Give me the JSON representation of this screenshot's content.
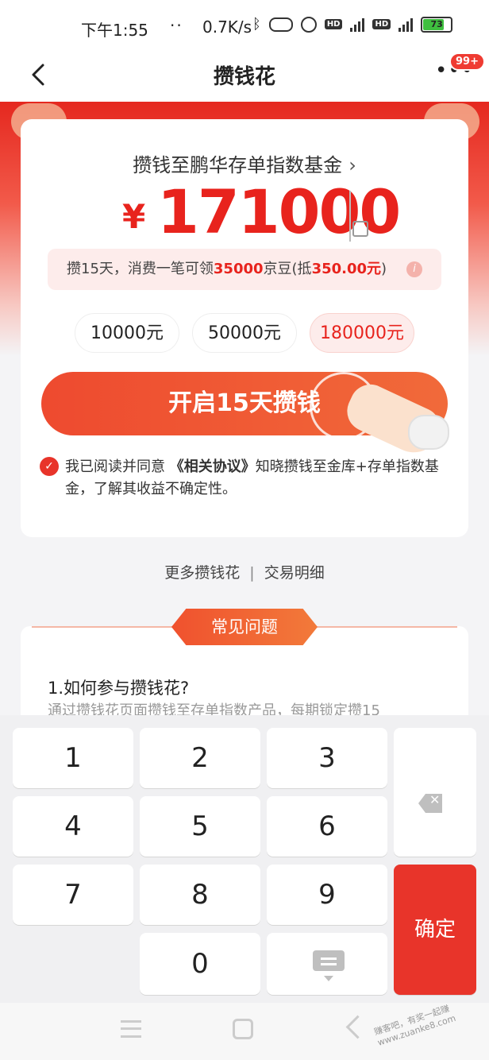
{
  "status_bar": {
    "time": "下午1:55",
    "dots": "··",
    "speed": "0.7K/s",
    "hd": "HD",
    "battery": "73"
  },
  "nav": {
    "title": "攒钱花",
    "badge": "99+"
  },
  "main": {
    "fund_link": "攒钱至鹏华存单指数基金",
    "currency": "¥",
    "amount": "171000",
    "tip": {
      "prefix": "攒15天，消费一笔可领",
      "beans": "35000",
      "mid": "京豆(抵",
      "value": "350.00元",
      "suffix": ")"
    },
    "chips": [
      {
        "label": "10000元"
      },
      {
        "label": "50000元"
      },
      {
        "label": "180000元"
      }
    ],
    "cta_label": "开启15天攒钱",
    "agree": {
      "prefix": "我已阅读并同意 ",
      "link": "《相关协议》",
      "suffix": "知晓攒钱至金库+存单指数基金，了解其收益不确定性。"
    }
  },
  "links": {
    "more": "更多攒钱花",
    "sep": "|",
    "detail": "交易明细"
  },
  "faq": {
    "tab": "常见问题",
    "q1": "1.如何参与攒钱花?",
    "a1": "通过攒钱花页面攒钱至存单指数产品，每期锁定攒15"
  },
  "keyboard": {
    "keys": [
      "1",
      "2",
      "3",
      "4",
      "5",
      "6",
      "7",
      "8",
      "9",
      "0"
    ],
    "ok_label": "确定"
  },
  "watermark": "赚客吧，有奖一起赚 www.zuanke8.com"
}
